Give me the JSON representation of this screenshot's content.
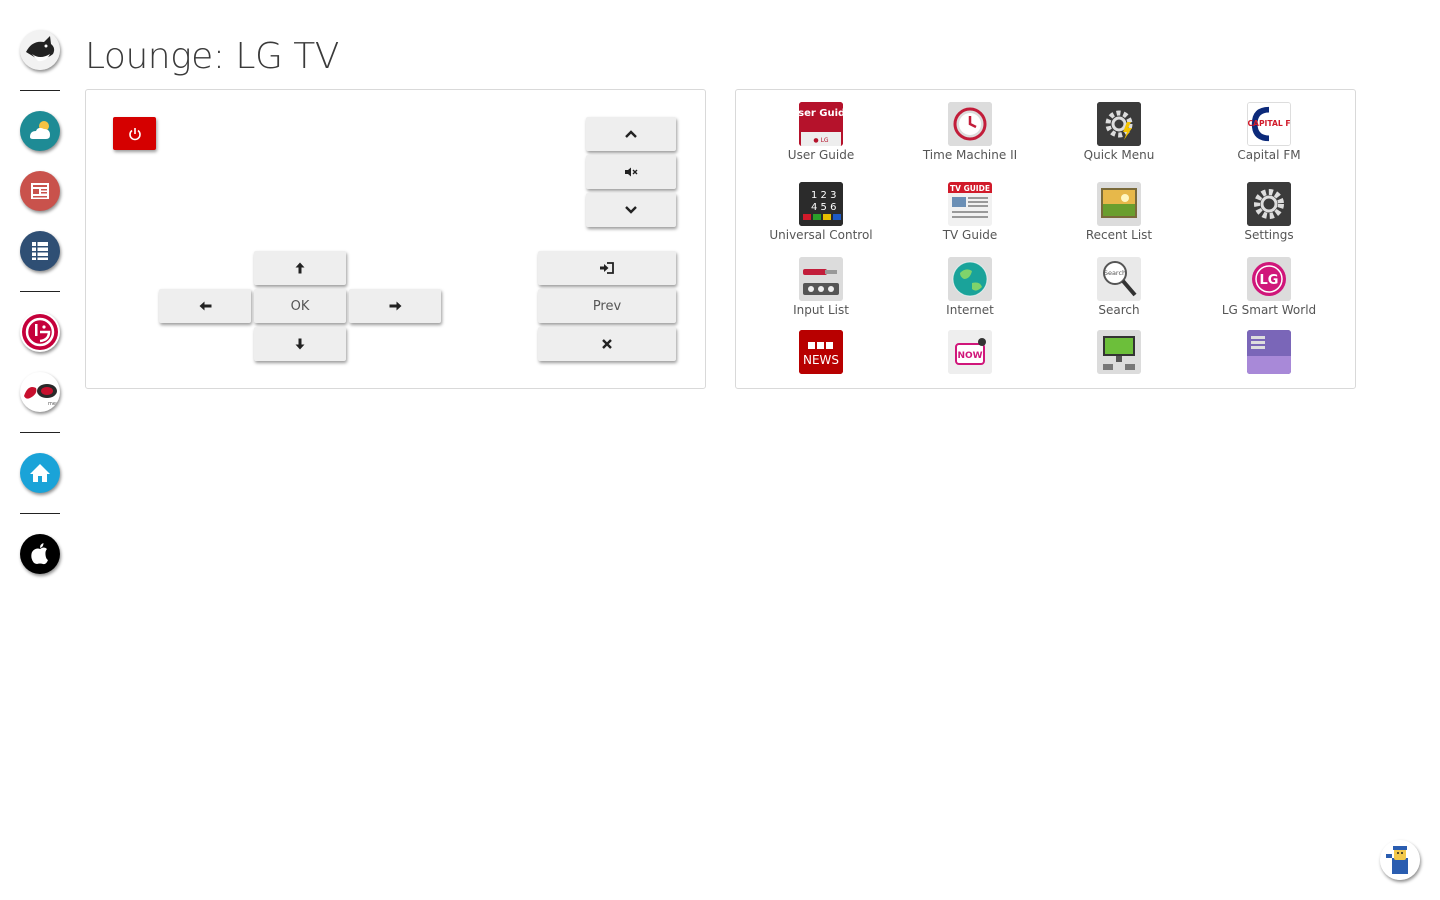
{
  "page": {
    "title": "Lounge: LG TV"
  },
  "sidebar": {
    "items": [
      {
        "name": "cat-logo-icon"
      },
      {
        "name": "weather-icon",
        "color": "#1e8b95"
      },
      {
        "name": "news-icon",
        "color": "#c9524c"
      },
      {
        "name": "list-icon",
        "color": "#2f4f74"
      },
      {
        "name": "lg-icon",
        "color": "#c5003b"
      },
      {
        "name": "virgin-media-icon"
      },
      {
        "name": "home-icon",
        "color": "#1aa3d8"
      },
      {
        "name": "apple-icon",
        "color": "#000000"
      }
    ]
  },
  "remote": {
    "ok_label": "OK",
    "prev_label": "Prev",
    "power_color": "#d50000"
  },
  "apps": [
    {
      "label": "User Guide",
      "icon": "user-guide-icon",
      "tile_text": "User Guide"
    },
    {
      "label": "Time Machine II",
      "icon": "time-machine-icon"
    },
    {
      "label": "Quick Menu",
      "icon": "quick-menu-icon"
    },
    {
      "label": "Capital FM",
      "icon": "capital-fm-icon",
      "tile_text": "CAPITAL FM"
    },
    {
      "label": "Universal Control",
      "icon": "universal-control-icon"
    },
    {
      "label": "TV Guide",
      "icon": "tv-guide-icon",
      "tile_text": "TV GUIDE"
    },
    {
      "label": "Recent List",
      "icon": "recent-list-icon"
    },
    {
      "label": "Settings",
      "icon": "settings-icon"
    },
    {
      "label": "Input List",
      "icon": "input-list-icon"
    },
    {
      "label": "Internet",
      "icon": "internet-icon"
    },
    {
      "label": "Search",
      "icon": "search-icon",
      "tile_text": "Search"
    },
    {
      "label": "LG Smart World",
      "icon": "lg-smart-world-icon",
      "tile_text": "LG"
    },
    {
      "label": "",
      "icon": "bbc-news-icon",
      "tile_text": "BBC NEWS"
    },
    {
      "label": "",
      "icon": "now-tv-icon",
      "tile_text": "NOW"
    },
    {
      "label": "",
      "icon": "screen-share-icon"
    },
    {
      "label": "",
      "icon": "photo-gallery-icon"
    }
  ]
}
